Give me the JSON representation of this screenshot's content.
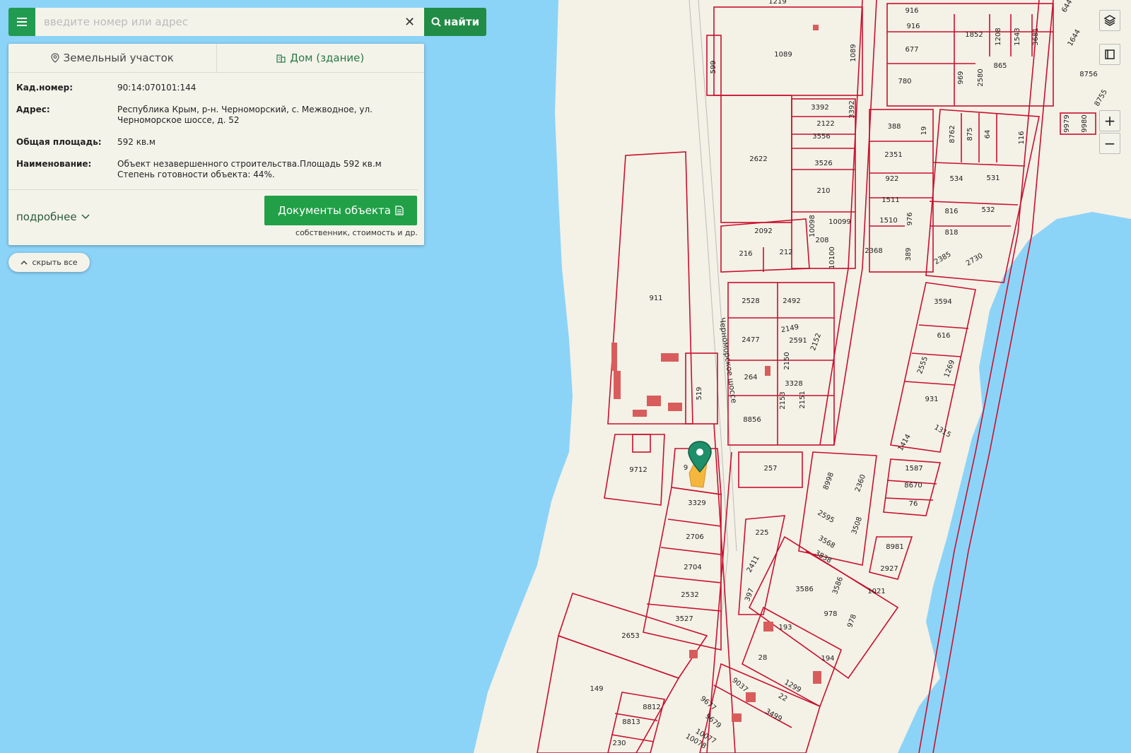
{
  "search": {
    "placeholder": "введите номер или адрес",
    "clear_icon": "close-icon",
    "button_label": "найти"
  },
  "tabs": [
    {
      "label": "Земельный участок",
      "icon": "location-pin-icon",
      "active": false
    },
    {
      "label": "Дом (здание)",
      "icon": "building-icon",
      "active": true
    }
  ],
  "object": {
    "cad_label": "Кад.номер:",
    "cad_value": "90:14:070101:144",
    "address_label": "Адрес:",
    "address_value": "Республика Крым, р-н. Черноморский, с. Межводное, ул. Черноморское шоссе, д. 52",
    "area_label": "Общая площадь:",
    "area_value": "592 кв.м",
    "name_label": "Наименование:",
    "name_value": "Объект незавершенного строительства.Площадь 592 кв.м Степень готовности объекта: 44%."
  },
  "more_label": "подробнее",
  "docs_button": "Документы объекта",
  "docs_note": "собственник, стоимость и др.",
  "hide_all": "скрыть все",
  "controls": {
    "layers": "layers-icon",
    "fullscreen": "fullscreen-icon",
    "zoom_in": "+",
    "zoom_out": "−"
  },
  "colors": {
    "water": "#8cd3f8",
    "land": "#f4f1e6",
    "parcel": "#c8102e",
    "accent": "#219b4f"
  },
  "map": {
    "road_label": "Черноморское шоссе",
    "parcel_labels": [
      "1089",
      "599",
      "1089",
      "916",
      "916",
      "677",
      "1852",
      "1208",
      "1543",
      "3681",
      "780",
      "969",
      "2580",
      "865",
      "3392",
      "2122",
      "3556",
      "3392",
      "2622",
      "3526",
      "210",
      "2092",
      "10098",
      "10099",
      "208",
      "216",
      "212",
      "10100",
      "388",
      "19",
      "2351",
      "922",
      "1511",
      "1510",
      "976",
      "2368",
      "389",
      "8762",
      "875",
      "64",
      "116",
      "534",
      "531",
      "816",
      "532",
      "818",
      "2385",
      "2730",
      "8756",
      "9979",
      "9980",
      "8755",
      "1644",
      "644",
      "911",
      "519",
      "2528",
      "2492",
      "2477",
      "2149",
      "2591",
      "2152",
      "264",
      "2150",
      "3328",
      "2153",
      "2151",
      "8856",
      "3594",
      "616",
      "2555",
      "1269",
      "931",
      "1315",
      "1414",
      "9712",
      "9",
      "257",
      "8998",
      "2360",
      "1587",
      "8670",
      "76",
      "3329",
      "2706",
      "2704",
      "2532",
      "3527",
      "225",
      "2411",
      "397",
      "2595",
      "3568",
      "3838",
      "3508",
      "3586",
      "1021",
      "8981",
      "2927",
      "3586",
      "978",
      "978",
      "2653",
      "193",
      "28",
      "194",
      "149",
      "9037",
      "1299",
      "22",
      "3499",
      "9677",
      "9679",
      "8812",
      "8813",
      "10077",
      "10078",
      "230",
      "1219"
    ]
  }
}
